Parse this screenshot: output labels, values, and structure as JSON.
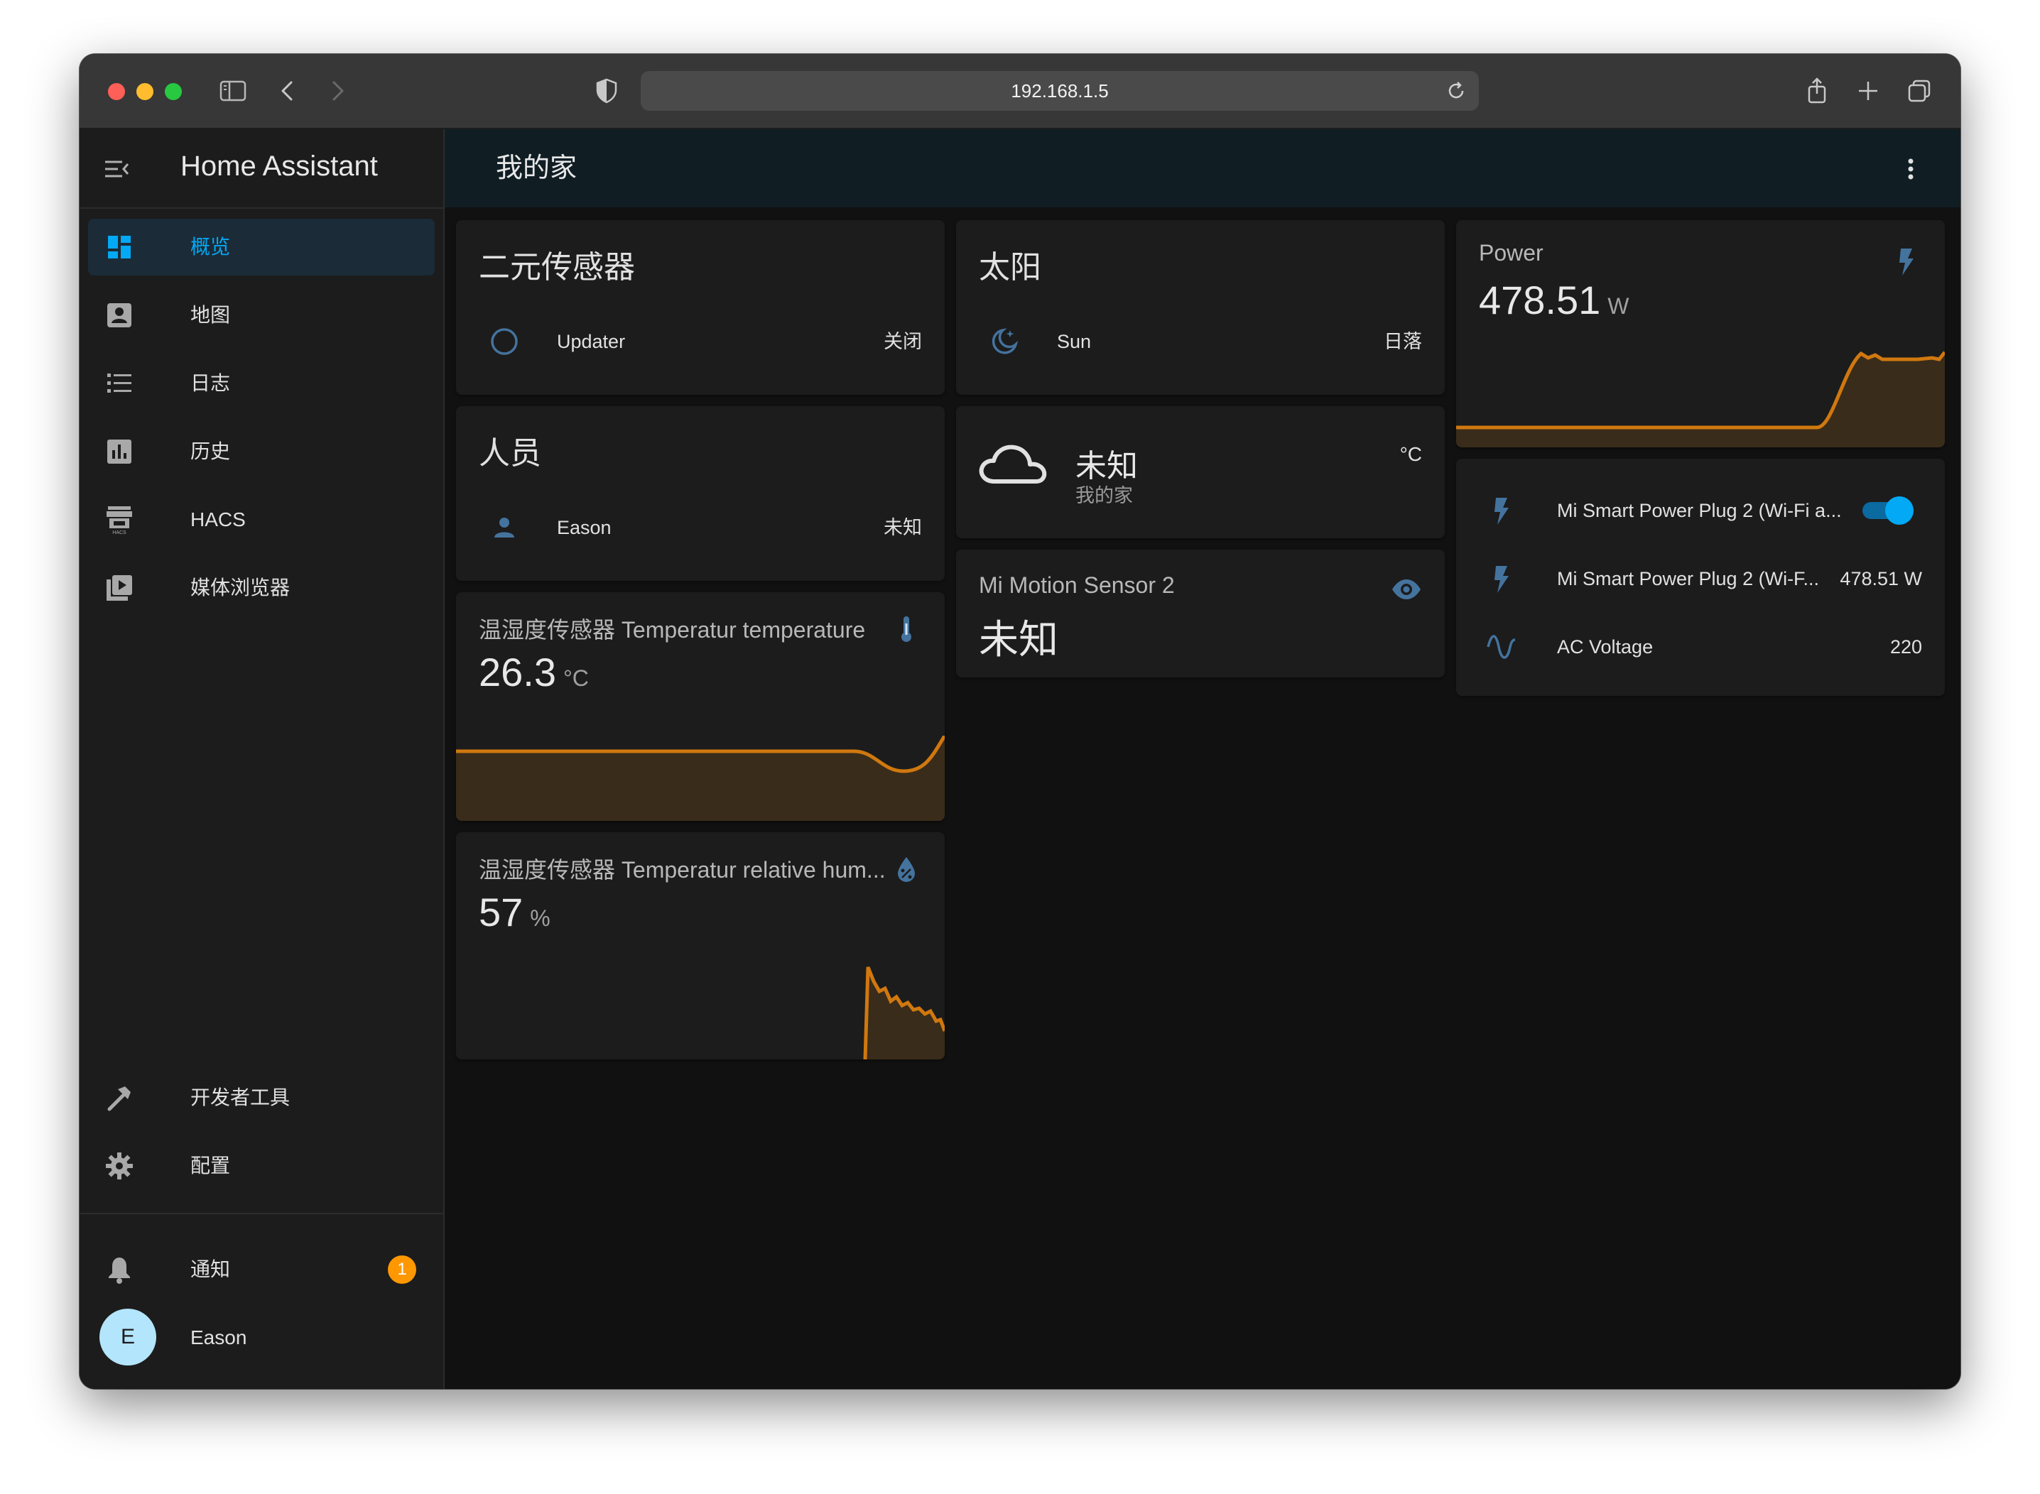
{
  "browser": {
    "url": "192.168.1.5"
  },
  "sidebar": {
    "app_title": "Home Assistant",
    "items": [
      {
        "label": "概览",
        "icon": "dashboard-icon",
        "active": true
      },
      {
        "label": "地图",
        "icon": "map-account-icon"
      },
      {
        "label": "日志",
        "icon": "logbook-icon"
      },
      {
        "label": "历史",
        "icon": "history-chart-icon"
      },
      {
        "label": "HACS",
        "icon": "hacs-icon"
      },
      {
        "label": "媒体浏览器",
        "icon": "media-browser-icon"
      }
    ],
    "bottom_items": [
      {
        "label": "开发者工具",
        "icon": "hammer-icon"
      },
      {
        "label": "配置",
        "icon": "gear-icon"
      }
    ],
    "notifications": {
      "label": "通知",
      "count": "1"
    },
    "user": {
      "initial": "E",
      "name": "Eason"
    }
  },
  "header": {
    "title": "我的家"
  },
  "cards": {
    "binary_sensor": {
      "title": "二元传感器",
      "rows": [
        {
          "name": "Updater",
          "state": "关闭",
          "icon": "circle-outline-icon"
        }
      ]
    },
    "sun": {
      "title": "太阳",
      "rows": [
        {
          "name": "Sun",
          "state": "日落",
          "icon": "weather-night-icon"
        }
      ]
    },
    "person": {
      "title": "人员",
      "rows": [
        {
          "name": "Eason",
          "state": "未知",
          "icon": "account-icon"
        }
      ]
    },
    "weather": {
      "state": "未知",
      "location": "我的家",
      "unit": "°C",
      "icon": "cloud-icon"
    },
    "motion": {
      "name": "Mi Motion Sensor 2",
      "state": "未知",
      "icon": "eye-icon"
    },
    "temperature": {
      "name": "温湿度传感器 Temperatur temperature",
      "value": "26.3",
      "unit": "°C",
      "icon": "thermometer-icon"
    },
    "humidity": {
      "name": "温湿度传感器 Temperatur relative hum...",
      "value": "57",
      "unit": "%",
      "icon": "water-percent-icon"
    },
    "power": {
      "name": "Power",
      "value": "478.51",
      "unit": "W",
      "icon": "flash-icon"
    },
    "entities": {
      "rows": [
        {
          "name": "Mi Smart Power Plug 2 (Wi-Fi a...",
          "state": "on",
          "icon": "flash-icon"
        },
        {
          "name": "Mi Smart Power Plug 2 (Wi-F...",
          "state": "478.51 W",
          "icon": "flash-icon"
        },
        {
          "name": "AC Voltage",
          "state": "220",
          "icon": "sine-wave-icon"
        }
      ]
    }
  },
  "colors": {
    "accent": "#03a9f4",
    "icon_blue": "#44739e",
    "graph_line": "#d0780f",
    "graph_fill": "#3a2c1a",
    "badge": "#ff9800"
  }
}
